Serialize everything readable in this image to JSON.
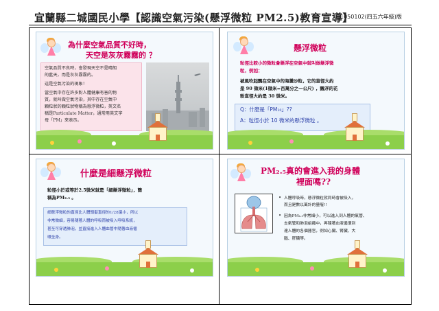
{
  "header": {
    "title": "宜蘭縣二城國民小學【認識空氣污染(懸浮微粒 PM2.5)教育宣導】",
    "date": "1050102(四五六年級)版"
  },
  "slide1": {
    "title_line1": "為什麼空氣品質不好時，",
    "title_line2": "天空是灰灰霧霧的 ？",
    "para1": [
      "空氣品質不良時，會發現天空不是晴朗",
      "的藍天，而是灰灰霧霧的。"
    ],
    "para2": "這是空氣污染的現象！",
    "para3": [
      "當空氣中存在許多對人體健康有害的物",
      "質，就叫做空氣污染，其中存在空氣中",
      "顆粒狀的顆粒狀物稱為懸浮微粒，英文名",
      "稱是Particulate Matter，通常用英文字",
      "母「PM」來表示。"
    ]
  },
  "slide2": {
    "title": "懸浮微粒",
    "intro": [
      "粒徑比較小的微粒會懸浮在空氣中就叫做懸浮微",
      "粒，例如："
    ],
    "body": [
      "被風吹起飄在空氣中的海灘沙粒，它的直徑大約",
      "是 90 微米(1微米=百萬分之一公尺) ，飄浮的花",
      "粉直徑大約是 30 微米。"
    ],
    "q": "Q：什麼是「PM₁₀」??",
    "a": "A：粒徑小於 10 微米的懸浮微粒 。"
  },
  "slide3": {
    "title": "什麼是細懸浮微粒",
    "intro": [
      "粒徑小於或等於2.5微米就是「細懸浮微粒」，簡",
      "稱為PM₂.₅ 。"
    ],
    "box": [
      "細懸浮微粒的直徑比人體頭髮直徑的1/28還小，所以",
      "非常微細，容易隨著人體的呼吸而被吸入呼吸系統，",
      "甚至可穿透肺泡，並直接進入人體血管中隨著血液循",
      "環全身。"
    ]
  },
  "slide4": {
    "title_line1": "PM₂.₅真的會進入我的身體",
    "title_line2": "裡面嗎??",
    "bullet1": [
      "人體呼吸時，懸浮微粒就同時會被吸入，",
      "而且是數以萬計的量喔!!"
    ],
    "bullet2": [
      "因為PM₂.₅非常細小，可以進入到人體的氣管、",
      "支氣管和肺泡組織中，再隨著血液循環到",
      "達人體的各個器官，例如心臟、腎臟、大",
      "腦、肝臟等。"
    ]
  },
  "colors": {
    "title_pink": "#d0005a",
    "title_blue": "#2a3ea8"
  }
}
